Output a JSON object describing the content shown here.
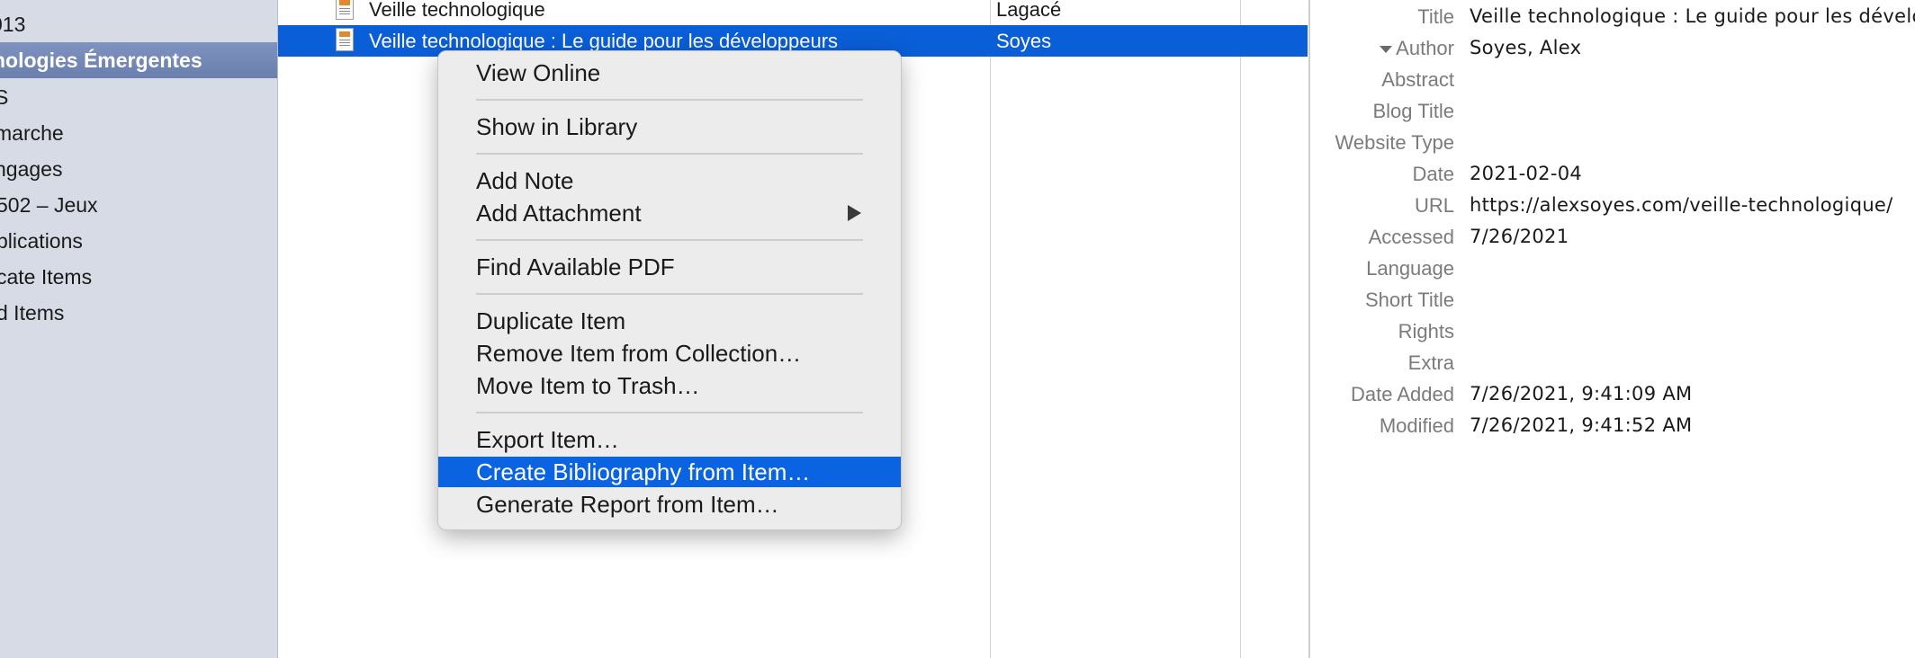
{
  "sidebar": {
    "items": [
      {
        "label": "013"
      },
      {
        "label": "nologies Émergentes"
      },
      {
        "label": "S"
      },
      {
        "label": "marche"
      },
      {
        "label": "ngages"
      },
      {
        "label": "502 – Jeux"
      },
      {
        "label": "blications"
      },
      {
        "label": "cate Items"
      },
      {
        "label": "d Items"
      }
    ]
  },
  "items_list": {
    "rows": [
      {
        "title": "Veille technologique",
        "creator": "Lagacé"
      },
      {
        "title": "Veille technologique : Le guide pour les développeurs",
        "creator": "Soyes"
      }
    ]
  },
  "context_menu": {
    "view_online": "View Online",
    "show_in_library": "Show in Library",
    "add_note": "Add Note",
    "add_attachment": "Add Attachment",
    "find_pdf": "Find Available PDF",
    "duplicate_item": "Duplicate Item",
    "remove_from_collection": "Remove Item from Collection…",
    "move_to_trash": "Move Item to Trash…",
    "export_item": "Export Item…",
    "create_bibliography": "Create Bibliography from Item…",
    "generate_report": "Generate Report from Item…"
  },
  "info": {
    "fields": [
      {
        "label": "Title",
        "value": "Veille technologique : Le guide pour les dévelo"
      },
      {
        "label": "Author",
        "value": "Soyes, Alex"
      },
      {
        "label": "Abstract",
        "value": ""
      },
      {
        "label": "Blog Title",
        "value": ""
      },
      {
        "label": "Website Type",
        "value": ""
      },
      {
        "label": "Date",
        "value": "2021-02-04"
      },
      {
        "label": "URL",
        "value": "https://alexsoyes.com/veille-technologique/"
      },
      {
        "label": "Accessed",
        "value": "7/26/2021"
      },
      {
        "label": "Language",
        "value": ""
      },
      {
        "label": "Short Title",
        "value": ""
      },
      {
        "label": "Rights",
        "value": ""
      },
      {
        "label": "Extra",
        "value": ""
      },
      {
        "label": "Date Added",
        "value": "7/26/2021, 9:41:09 AM"
      },
      {
        "label": "Modified",
        "value": "7/26/2021, 9:41:52 AM"
      }
    ]
  },
  "colors": {
    "selection": "#0a5fd8",
    "menu_highlight": "#0a63e0",
    "sidebar_bg": "#d6dbe5",
    "sidebar_selected": "#6b7fae"
  },
  "icons": [
    "document-icon",
    "disclosure-triangle-icon",
    "submenu-arrow-icon"
  ]
}
